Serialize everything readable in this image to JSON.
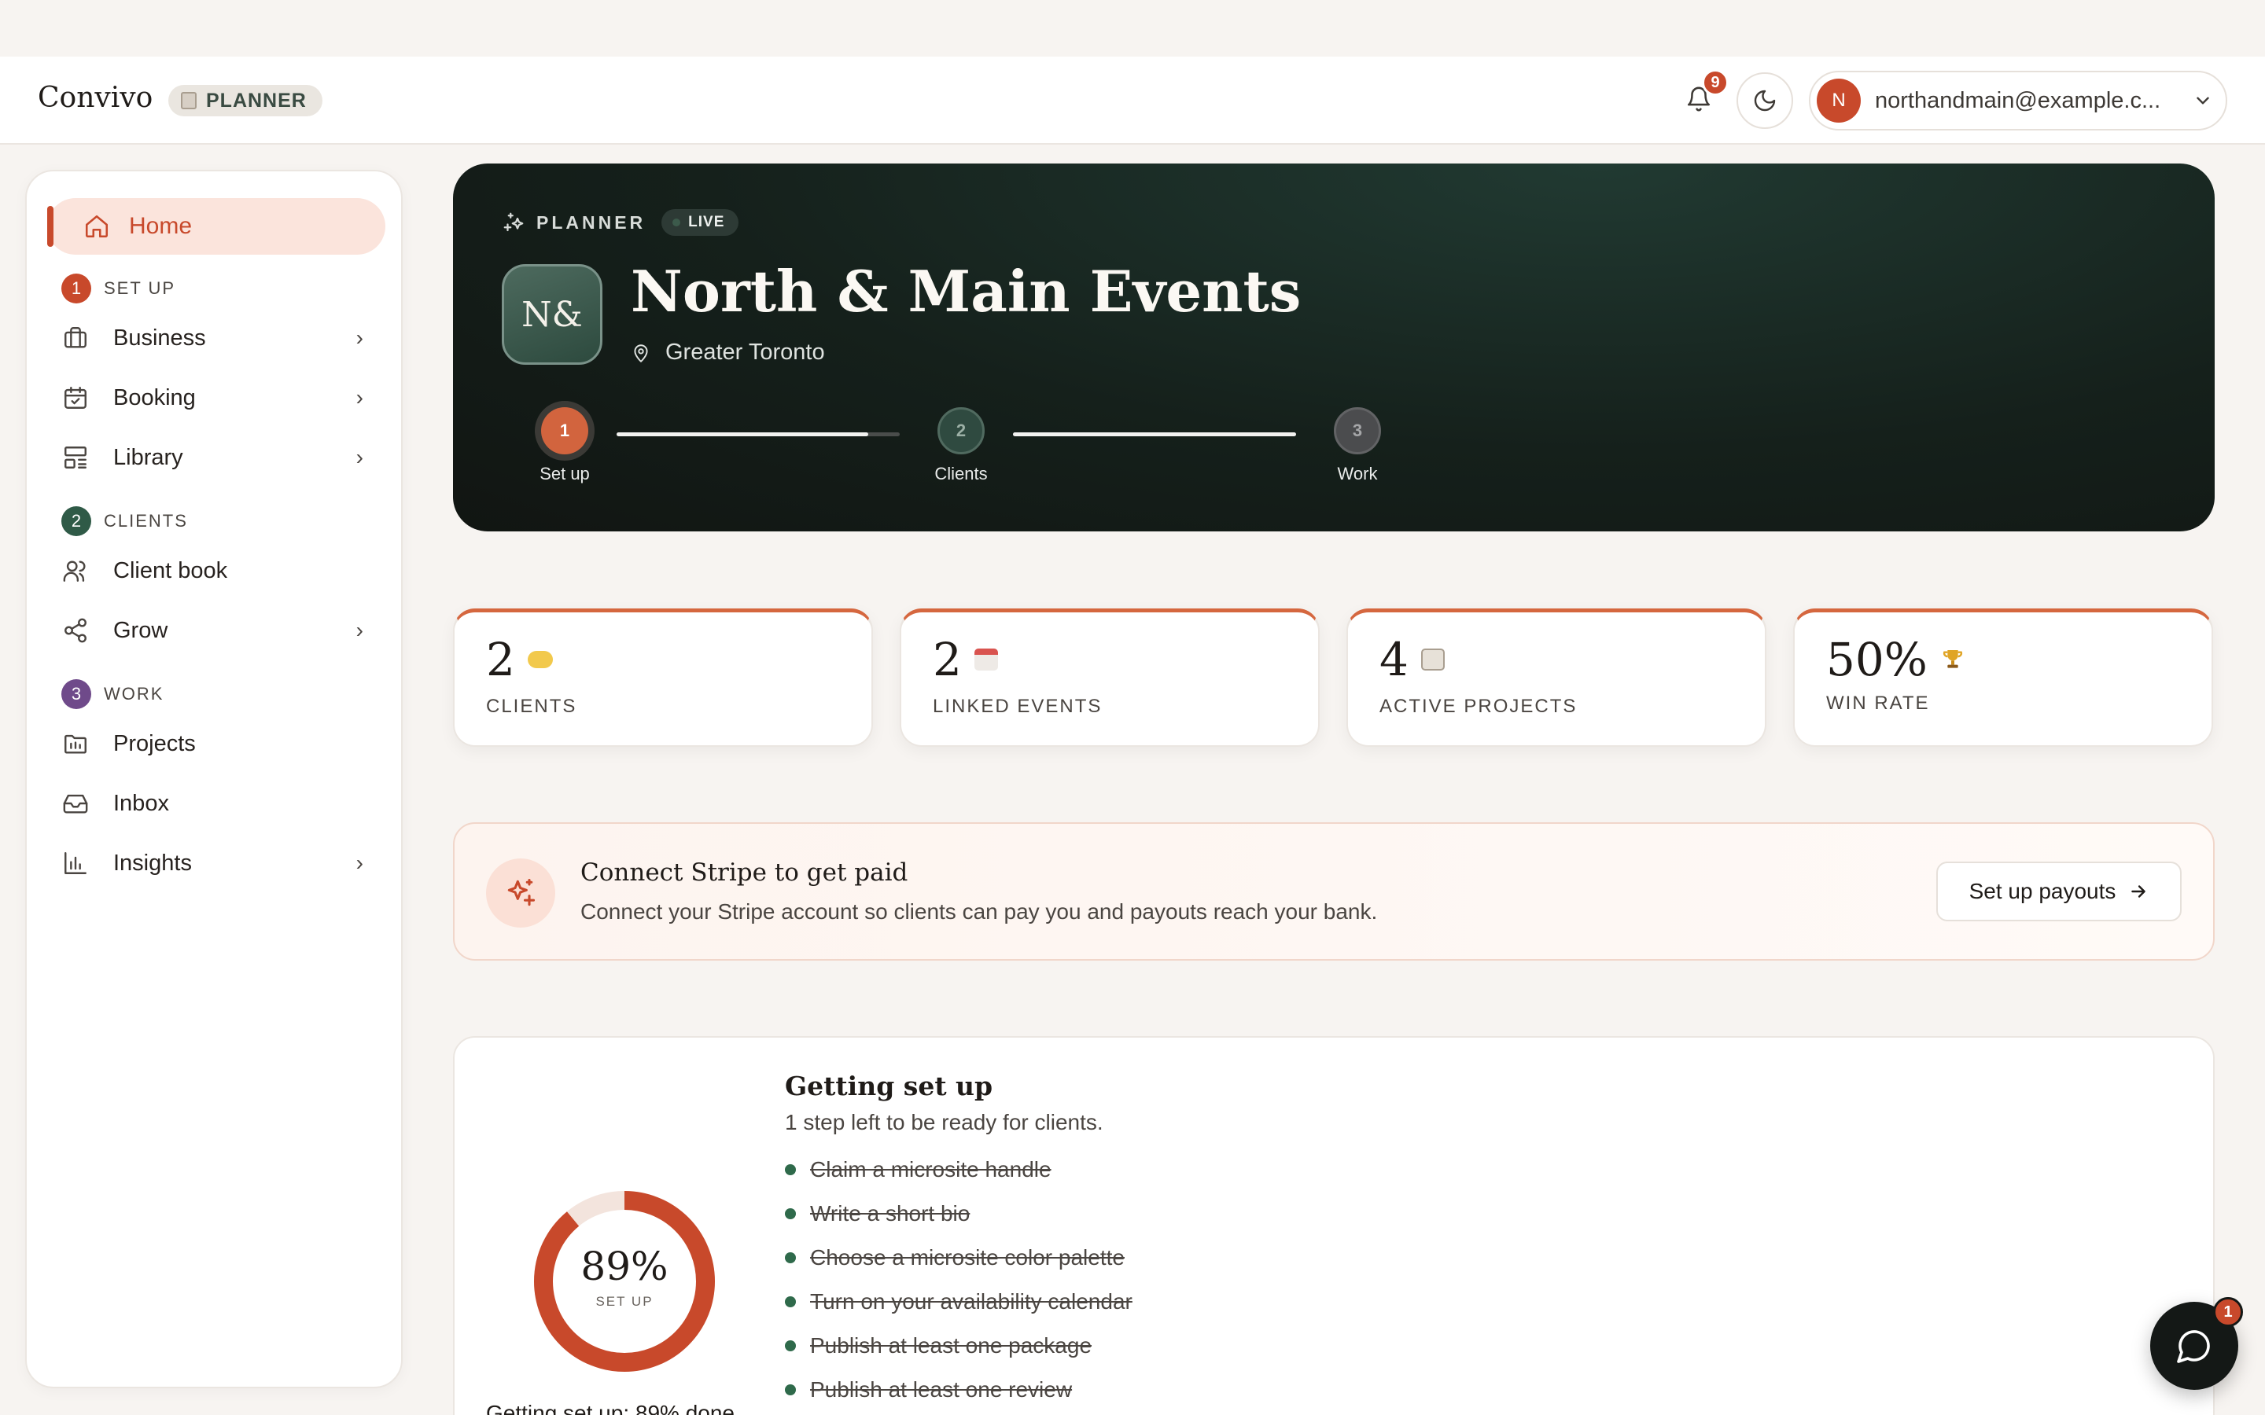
{
  "app": {
    "logo": "Convivo",
    "role": "PLANNER"
  },
  "header": {
    "notifications_count": "9",
    "user_initial": "N",
    "user_email": "northandmain@example.c..."
  },
  "sidebar": {
    "home": "Home",
    "sections": [
      {
        "num": "1",
        "title": "SET UP",
        "items": [
          "Business",
          "Booking",
          "Library"
        ]
      },
      {
        "num": "2",
        "title": "CLIENTS",
        "items": [
          "Client book",
          "Grow"
        ]
      },
      {
        "num": "3",
        "title": "WORK",
        "items": [
          "Projects",
          "Inbox",
          "Insights"
        ]
      }
    ]
  },
  "hero": {
    "eyebrow": "PLANNER",
    "status": "LIVE",
    "monogram": "N&",
    "title": "North & Main Events",
    "location": "Greater Toronto",
    "steps": [
      {
        "num": "1",
        "label": "Set up"
      },
      {
        "num": "2",
        "label": "Clients"
      },
      {
        "num": "3",
        "label": "Work"
      }
    ],
    "progress": [
      0.89,
      1.0
    ]
  },
  "stats": [
    {
      "value": "2",
      "label": "CLIENTS",
      "icon": "handshake-icon"
    },
    {
      "value": "2",
      "label": "LINKED EVENTS",
      "icon": "calendar-icon"
    },
    {
      "value": "4",
      "label": "ACTIVE PROJECTS",
      "icon": "clipboard-icon"
    },
    {
      "value": "50%",
      "label": "WIN RATE",
      "icon": "trophy-icon"
    }
  ],
  "stripe": {
    "title": "Connect Stripe to get paid",
    "subtitle": "Connect your Stripe account so clients can pay you and payouts reach your bank.",
    "button": "Set up payouts"
  },
  "setup": {
    "title": "Getting set up",
    "subtitle": "1 step left to be ready for clients.",
    "percent_value": 0.89,
    "percent": "89%",
    "percent_label": "SET UP",
    "caption": "Getting set up: 89% done",
    "todos": [
      "Claim a microsite handle",
      "Write a short bio",
      "Choose a microsite color palette",
      "Turn on your availability calendar",
      "Publish at least one package",
      "Publish at least one review"
    ]
  },
  "chat": {
    "badge": "1"
  },
  "colors": {
    "accent": "#c8492b",
    "hero_bg": "#15201b",
    "clients": "#2f5a47",
    "work": "#6f4a8a"
  }
}
